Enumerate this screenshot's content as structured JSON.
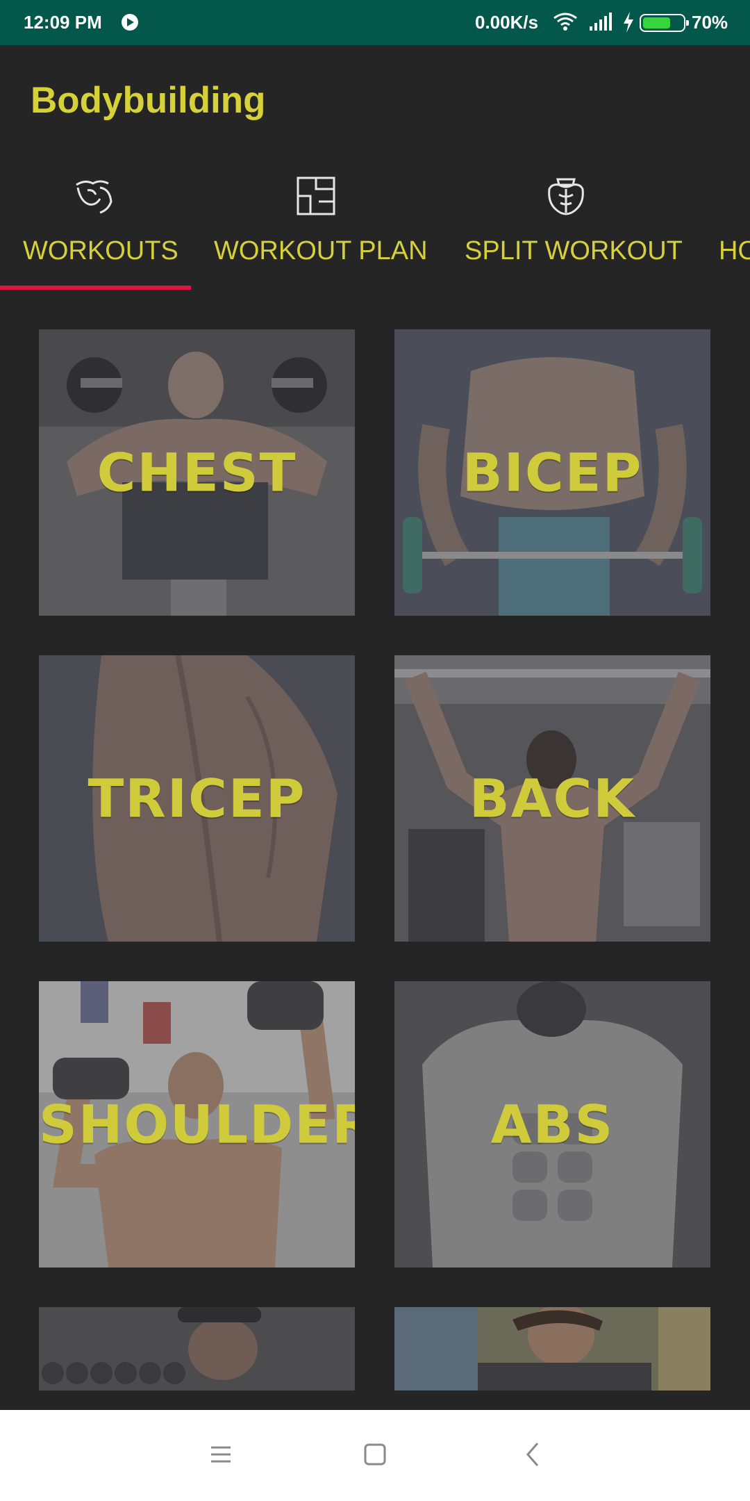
{
  "status_bar": {
    "time": "12:09 PM",
    "network_speed": "0.00K/s",
    "battery_percent": "70%",
    "battery_level": 0.7,
    "battery_color": "#38d43c",
    "background": "#03574b"
  },
  "app": {
    "title": "Bodybuilding",
    "accent_color": "#d7d139",
    "indicator_color": "#e0143e"
  },
  "tabs": [
    {
      "label": "WORKOUTS",
      "icon": "bicep-flex-icon",
      "selected": true
    },
    {
      "label": "WORKOUT PLAN",
      "icon": "floor-plan-icon",
      "selected": false
    },
    {
      "label": "SPLIT WORKOUT",
      "icon": "muscle-torso-icon",
      "selected": false
    },
    {
      "label": "HO",
      "icon": "",
      "selected": false
    }
  ],
  "workouts": [
    {
      "label": "CHEST",
      "image": "bench-press-photo"
    },
    {
      "label": "BICEP",
      "image": "barbell-curl-photo"
    },
    {
      "label": "TRICEP",
      "image": "tricep-back-photo"
    },
    {
      "label": "BACK",
      "image": "pull-up-photo"
    },
    {
      "label": "SHOULDER",
      "image": "shoulder-press-photo"
    },
    {
      "label": "ABS",
      "image": "abs-photo"
    },
    {
      "label": "",
      "image": "dumbbell-rack-photo"
    },
    {
      "label": "",
      "image": "gym-man-photo"
    }
  ],
  "nav_bar": {
    "menu_icon": "menu-icon",
    "home_icon": "home-square-icon",
    "back_icon": "back-chevron-icon"
  }
}
